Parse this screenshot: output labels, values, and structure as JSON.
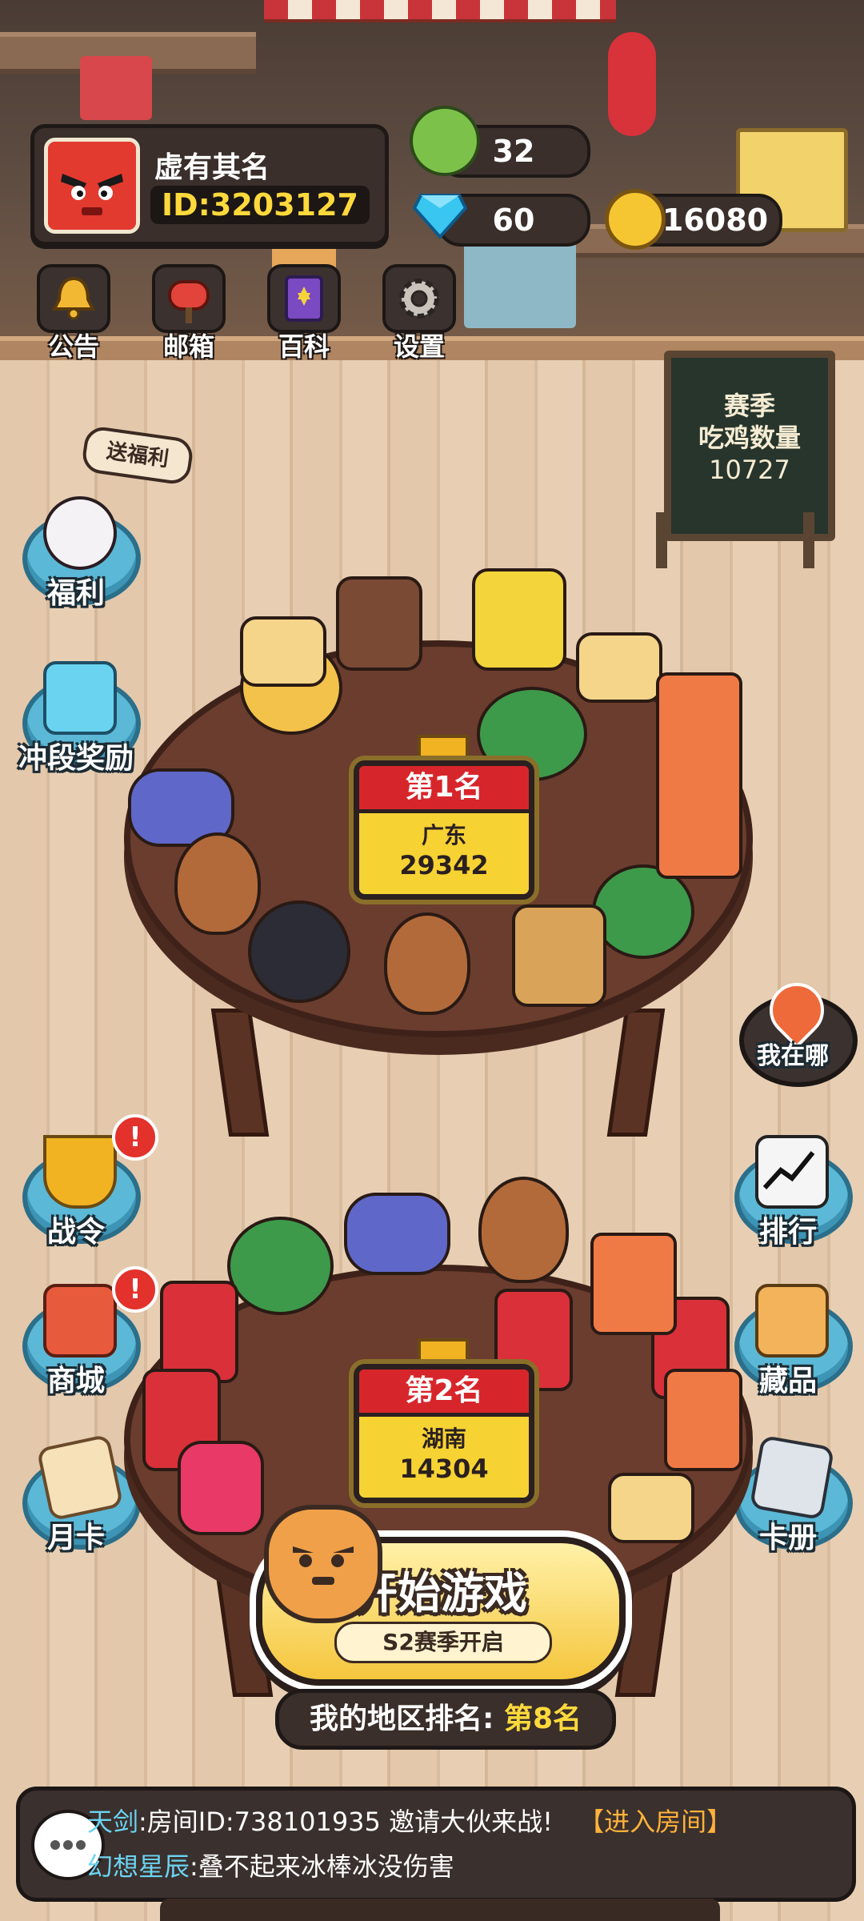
{
  "player": {
    "name": "虚有其名",
    "id_label": "ID:3203127"
  },
  "resources": {
    "energy": "32",
    "gems": "60",
    "coins": "16080"
  },
  "top_menu": [
    {
      "label": "公告",
      "icon": "bell-icon"
    },
    {
      "label": "邮箱",
      "icon": "mailbox-icon"
    },
    {
      "label": "百科",
      "icon": "encyclopedia-icon"
    },
    {
      "label": "设置",
      "icon": "gear-icon"
    }
  ],
  "chalkboard": {
    "line1": "赛季",
    "line2": "吃鸡数量",
    "value": "10727"
  },
  "left_buttons": {
    "welfare_tag": "送福利",
    "welfare": "福利",
    "rank_reward": "冲段奖励",
    "battle_pass": "战令",
    "shop": "商城",
    "monthly_card": "月卡"
  },
  "right_buttons": {
    "where_am_i": "我在哪",
    "leaderboard": "排行",
    "collection": "藏品",
    "card_album": "卡册"
  },
  "tables": [
    {
      "rank": "第1名",
      "region": "广东",
      "score": "29342"
    },
    {
      "rank": "第2名",
      "region": "湖南",
      "score": "14304"
    }
  ],
  "start": {
    "label": "开始游戏",
    "sub": "S2赛季开启"
  },
  "region_rank": {
    "prefix": "我的地区排名:",
    "value": "第8名"
  },
  "chat": [
    {
      "user": "天剑",
      "message": ":房间ID:738101935 邀请大伙来战!",
      "action": "【进入房间】"
    },
    {
      "user": "幻想星辰",
      "message": ":叠不起来冰棒冰没伤害",
      "action": ""
    }
  ],
  "colors": {
    "accent_yellow": "#ffd93c",
    "rank_red": "#d7262b",
    "side_button_blue": "#5bb8d6",
    "chat_user": "#6bd3f2",
    "chat_action": "#ffb23c"
  }
}
